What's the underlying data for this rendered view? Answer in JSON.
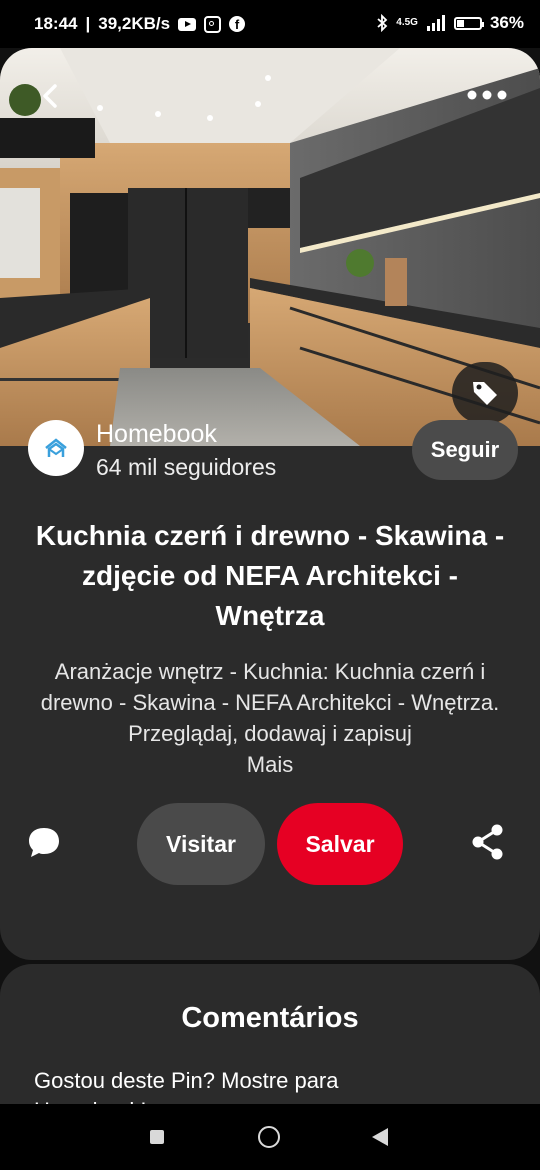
{
  "status_bar": {
    "time": "18:44",
    "speed": "39,2KB/s",
    "network": "4.5G",
    "battery": "36%",
    "battery_level": 0.36,
    "icons": [
      "youtube-icon",
      "instagram-icon",
      "facebook-icon",
      "bluetooth-icon",
      "signal-icon",
      "battery-icon"
    ]
  },
  "hero": {
    "image_alt": "Kitchen interior with black and wood cabinets",
    "icons": [
      "back-icon",
      "more-icon",
      "tag-icon"
    ]
  },
  "profile": {
    "name": "Homebook",
    "followers": "64 mil seguidores",
    "follow_label": "Seguir"
  },
  "pin": {
    "title": "Kuchnia czerń i drewno - Skawina - zdjęcie od NEFA Architekci - Wnętrza",
    "description": "Aranżacje wnętrz - Kuchnia: Kuchnia czerń i drewno - Skawina - NEFA Architekci - Wnętrza. Przeglądaj, dodawaj i zapisuj",
    "more_label": "Mais"
  },
  "actions": {
    "visit_label": "Visitar",
    "save_label": "Salvar",
    "save_color": "#e60023"
  },
  "comments": {
    "title": "Comentários",
    "prompt": "Gostou deste Pin? Mostre para Homebook!"
  }
}
